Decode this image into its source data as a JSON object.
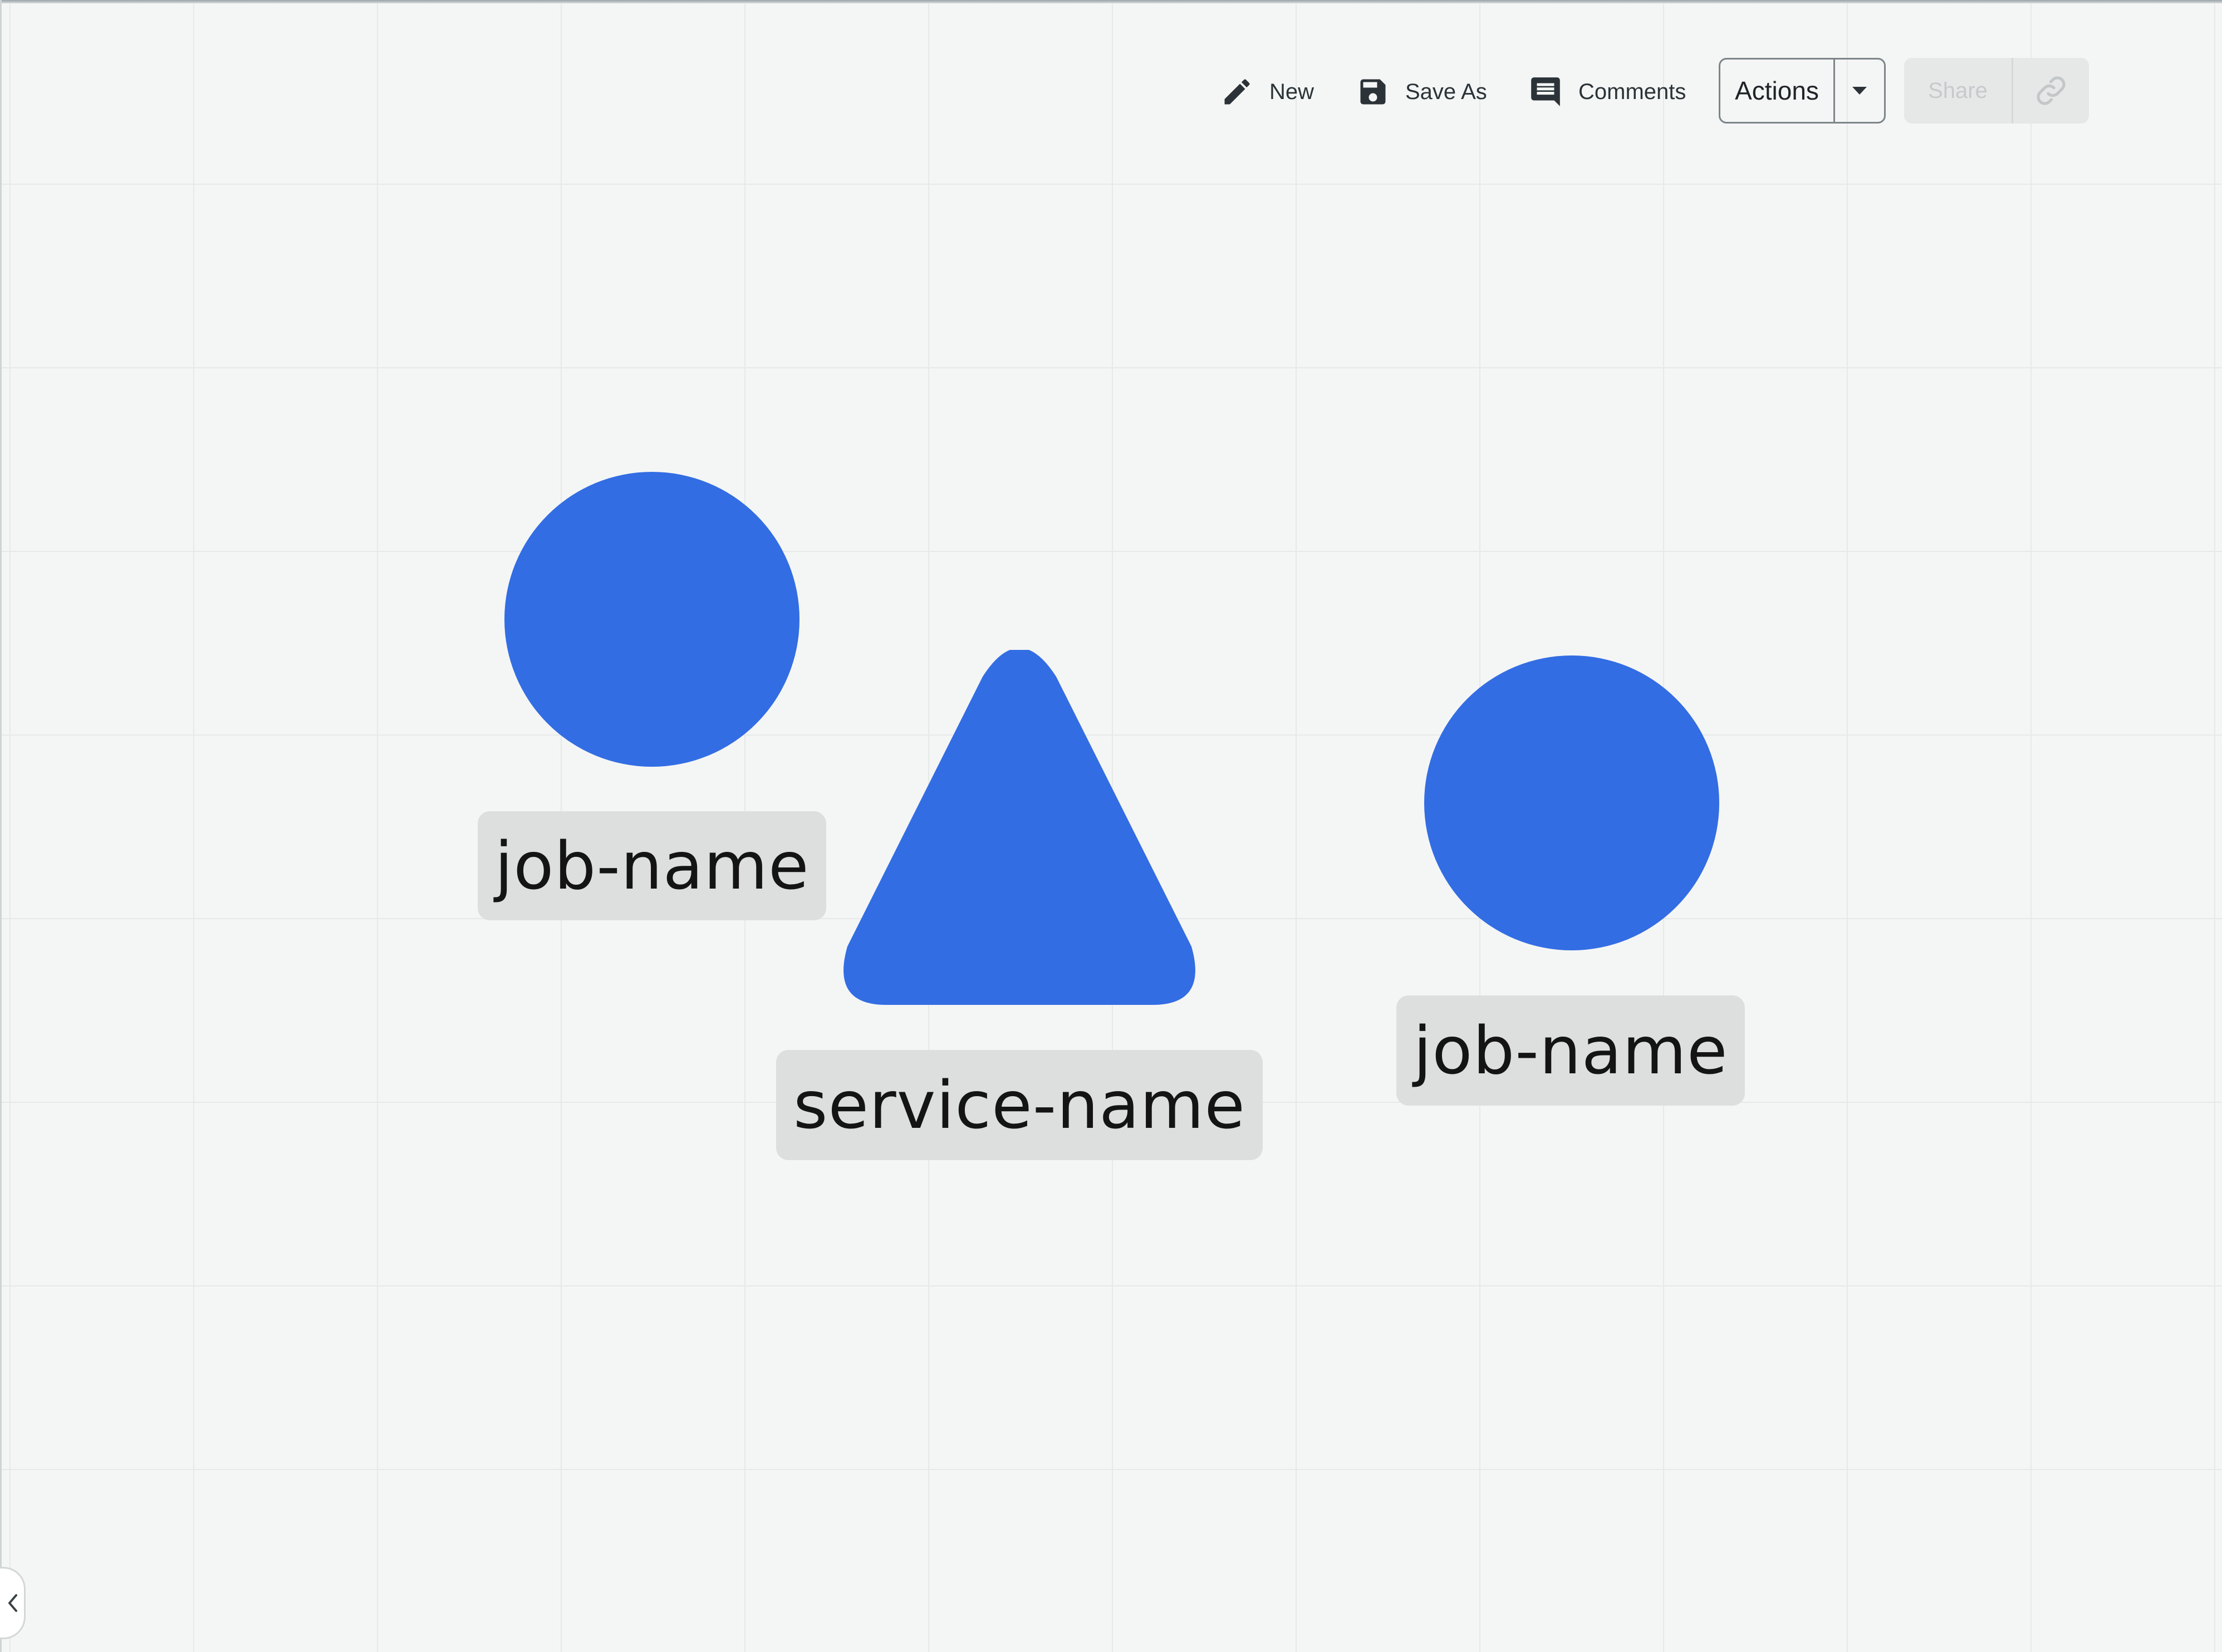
{
  "toolbar": {
    "new_label": "New",
    "save_as_label": "Save As",
    "comments_label": "Comments",
    "actions_label": "Actions",
    "share_label": "Share"
  },
  "canvas": {
    "shapes": [
      {
        "shape": "circle",
        "color": "#336de3",
        "label": "job-name"
      },
      {
        "shape": "triangle",
        "color": "#336de3",
        "label": "service-name"
      },
      {
        "shape": "circle",
        "color": "#336de3",
        "label": "job-name"
      }
    ]
  },
  "icons": [
    "pencil-icon",
    "floppy-disk-icon",
    "comment-icon",
    "caret-down-icon",
    "link-icon",
    "chevron-left-icon"
  ]
}
